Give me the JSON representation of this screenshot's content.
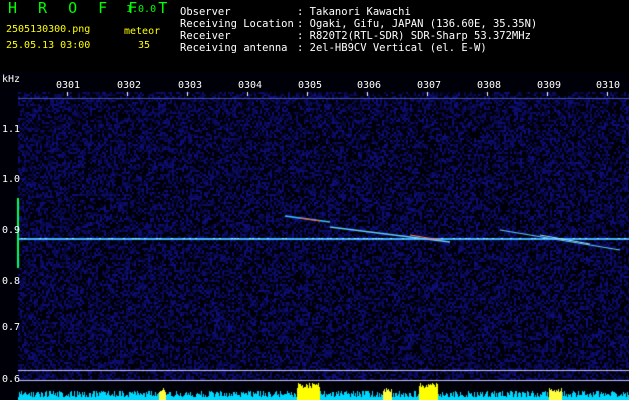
{
  "header": {
    "app_name": "H R O F F T",
    "version": "1.0.0",
    "filename": "2505130300.png",
    "datetime": "25.05.13 03:00",
    "meteor_label": "meteor",
    "meteor_count": "35",
    "info_labels": [
      "Observer",
      "Receiving Location",
      "Receiver",
      "Receiving antenna"
    ],
    "info_values": [
      ": Takanori Kawachi",
      ": Ogaki, Gifu, JAPAN (136.60E, 35.35N)",
      ": R820T2(RTL-SDR) SDR-Sharp 53.372MHz",
      ": 2el-HB9CV Vertical (el. E-W)"
    ]
  },
  "axis": {
    "unit": "kHz",
    "y_ticks": [
      "1.1",
      "1.0",
      "0.9",
      "0.8",
      "0.7",
      "0.6"
    ],
    "x_ticks": [
      "0301",
      "0302",
      "0303",
      "0304",
      "0305",
      "0306",
      "0307",
      "0308",
      "0309",
      "0310"
    ]
  },
  "colors": {
    "background": "#000000",
    "noise": "#0c0c6a",
    "carrier": "#5fd0ff",
    "title": "#00ff00",
    "meta": "#ffff00",
    "info": "#ffffff",
    "power": "#00e0ff",
    "power_peak": "#ffff00"
  }
}
